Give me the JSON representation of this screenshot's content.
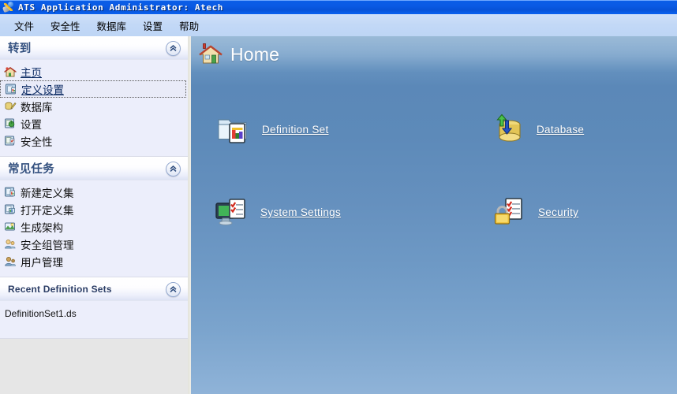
{
  "window": {
    "title": "ATS Application Administrator: Atech",
    "icon": "app-tools-icon"
  },
  "menubar": {
    "items": [
      {
        "label": "文件",
        "name": "menu-file"
      },
      {
        "label": "安全性",
        "name": "menu-security"
      },
      {
        "label": "数据库",
        "name": "menu-database"
      },
      {
        "label": "设置",
        "name": "menu-settings"
      },
      {
        "label": "帮助",
        "name": "menu-help"
      }
    ]
  },
  "sidebar": {
    "panels": [
      {
        "title": "转到",
        "collapse_icon": "chevron-up-icon",
        "items": [
          {
            "label": "主页",
            "icon": "home-icon",
            "link": true,
            "focused": false
          },
          {
            "label": "定义设置",
            "icon": "definition-set-icon",
            "link": true,
            "focused": true
          },
          {
            "label": "数据库",
            "icon": "database-pencil-icon",
            "link": false,
            "focused": false
          },
          {
            "label": "设置",
            "icon": "settings-icon",
            "link": false,
            "focused": false
          },
          {
            "label": "安全性",
            "icon": "security-icon",
            "link": false,
            "focused": false
          }
        ]
      },
      {
        "title": "常见任务",
        "collapse_icon": "chevron-up-icon",
        "items": [
          {
            "label": "新建定义集",
            "icon": "new-definition-set-icon",
            "link": false,
            "focused": false
          },
          {
            "label": "打开定义集",
            "icon": "open-definition-set-icon",
            "link": false,
            "focused": false
          },
          {
            "label": "生成架构",
            "icon": "generate-schema-icon",
            "link": false,
            "focused": false
          },
          {
            "label": "安全组管理",
            "icon": "security-group-icon",
            "link": false,
            "focused": false
          },
          {
            "label": "用户管理",
            "icon": "user-management-icon",
            "link": false,
            "focused": false
          }
        ]
      },
      {
        "title": "Recent Definition Sets",
        "collapse_icon": "chevron-up-icon",
        "recent": [
          "DefinitionSet1.ds"
        ]
      }
    ]
  },
  "main": {
    "header": {
      "title": "Home",
      "icon": "house-icon"
    },
    "tiles": [
      {
        "label": "Definition Set",
        "icon": "folder-blocks-icon"
      },
      {
        "label": "Database",
        "icon": "database-cylinder-arrows-icon"
      },
      {
        "label": "System Settings",
        "icon": "monitor-checklist-icon"
      },
      {
        "label": "Security",
        "icon": "padlock-checklist-icon"
      }
    ]
  },
  "colors": {
    "titlebar_blue": "#0a5ae4",
    "menubar_blue": "#c2d8f6",
    "panel_bg": "#eceefb",
    "panel_title": "#2b4a7d",
    "link_blue": "#0b2a63",
    "main_blue": "#5d8ab9",
    "sidebar_gray": "#e6e6e6"
  }
}
